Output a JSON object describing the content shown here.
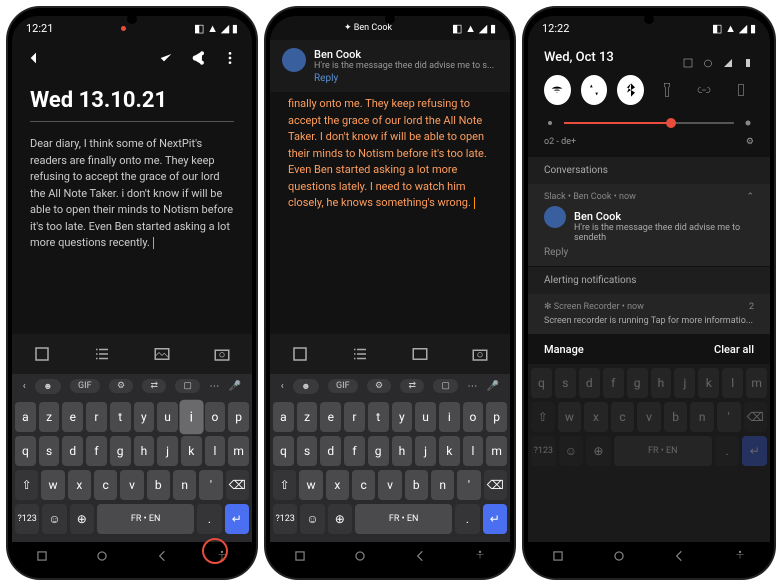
{
  "phone1": {
    "status": {
      "time": "12:21",
      "icons": "◧ ▲ ◢ ▮"
    },
    "title": "Wed 13.10.21",
    "body": "Dear diary, I think some of NextPit's readers are finally onto me. They keep refusing to accept the grace of our lord the All Note Taker. i don't know if will be able to open their minds to Notism before it's too late. Even Ben started asking a lot more questions recently. ",
    "toolbar": [
      "checkbox",
      "list",
      "image",
      "camera"
    ],
    "kb_sugg": {
      "gif": "GIF"
    },
    "kb_rows": [
      [
        "a",
        "z",
        "e",
        "r",
        "t",
        "y",
        "u",
        "i",
        "o",
        "p"
      ],
      [
        "q",
        "s",
        "d",
        "f",
        "g",
        "h",
        "j",
        "k",
        "l",
        "m"
      ],
      [
        "⇧",
        "w",
        "x",
        "c",
        "v",
        "b",
        "n",
        "'",
        "⌫"
      ],
      [
        "?123",
        "☺",
        "⊕",
        "FR • EN",
        ".",
        "↵"
      ]
    ],
    "kb_lang": "FR • EN",
    "sym": "?123"
  },
  "phone2": {
    "status_center": "✦ Ben Cook",
    "msg": {
      "name": "Ben Cook",
      "text": "H're is the message thee did advise me to s...",
      "reply": "Reply"
    },
    "body": "finally onto me. They keep refusing to accept the grace of our lord the All Note Taker. I don't know if will be able to open their minds to Notism before it's too late. Even Ben started asking a lot more questions lately. I need to watch him closely, he knows something's wrong. ",
    "kb_lang": "FR • EN",
    "sym": "?123"
  },
  "phone3": {
    "status": {
      "time": "12:22"
    },
    "date": "Wed, Oct 13",
    "carrier": "o2 - de+",
    "sections": {
      "conv": "Conversations",
      "alert": "Alerting notifications"
    },
    "notif1": {
      "app": "Slack  •  Ben Cook  •  now",
      "name": "Ben Cook",
      "msg": "H're is the message thee did advise me to sendeth",
      "reply": "Reply"
    },
    "notif2": {
      "app": "✻  Screen Recorder  •  now",
      "count": "2",
      "msg": "Screen recorder is running Tap for more informatio..."
    },
    "actions": {
      "manage": "Manage",
      "clear": "Clear all"
    },
    "kb_lang": "FR • EN",
    "sym": "?123"
  }
}
